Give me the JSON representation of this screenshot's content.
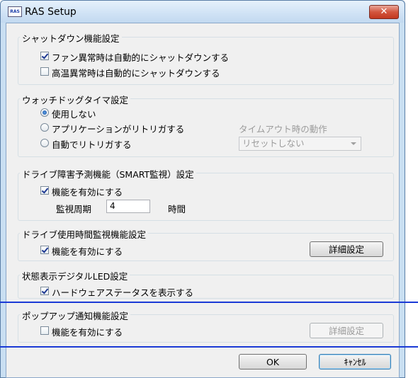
{
  "window": {
    "title": "RAS Setup",
    "icon_text": "RAS",
    "close_glyph": "✕"
  },
  "shutdown": {
    "title": "シャットダウン機能設定",
    "fan": {
      "label": "ファン異常時は自動的にシャットダウンする",
      "checked": true
    },
    "temp": {
      "label": "高温異常時は自動的にシャットダウンする",
      "checked": false
    }
  },
  "watchdog": {
    "title": "ウォッチドッグタイマ設定",
    "options": [
      {
        "label": "使用しない",
        "selected": true
      },
      {
        "label": "アプリケーションがリトリガする",
        "selected": false
      },
      {
        "label": "自動でリトリガする",
        "selected": false
      }
    ],
    "timeout_label": "タイムアウト時の動作",
    "timeout_value": "リセットしない"
  },
  "smart": {
    "title": "ドライブ障害予測機能（SMART監視）設定",
    "enable_label": "機能を有効にする",
    "enabled": true,
    "period_label": "監視周期",
    "period_value": "4",
    "period_unit": "時間"
  },
  "drive_time": {
    "title": "ドライブ使用時間監視機能設定",
    "enable_label": "機能を有効にする",
    "enabled": true,
    "detail_label": "詳細設定"
  },
  "led": {
    "title": "状態表示デジタルLED設定",
    "hw_label": "ハードウェアステータスを表示する",
    "enabled": true
  },
  "popup": {
    "title": "ポップアップ通知機能設定",
    "enable_label": "機能を有効にする",
    "enabled": false,
    "detail_label": "詳細設定"
  },
  "footer": {
    "ok_label": "OK",
    "cancel_label": "ｷｬﾝｾﾙ"
  },
  "colors": {
    "highlight_line": "#1a3ad6",
    "close_red": "#c2381f"
  }
}
